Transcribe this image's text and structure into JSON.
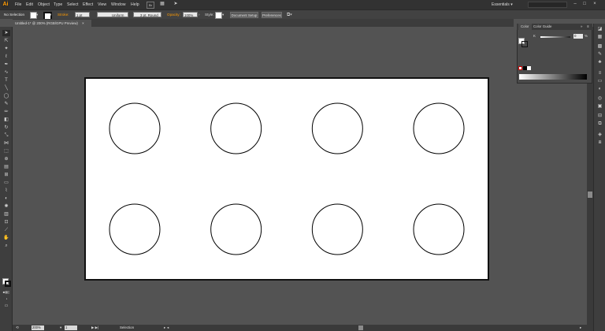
{
  "app": {
    "logo": "Ai"
  },
  "menu": [
    "File",
    "Edit",
    "Object",
    "Type",
    "Select",
    "Effect",
    "View",
    "Window",
    "Help"
  ],
  "workspace": "Essentials",
  "control_bar": {
    "selection_label": "No Selection",
    "stroke_label": "Stroke:",
    "stroke_weight": "1 pt",
    "profile": "Uniform",
    "brush": "3 pt. Round",
    "opacity_label": "Opacity:",
    "opacity_value": "100%",
    "style_label": "Style:",
    "document_setup": "Document Setup",
    "preferences": "Preferences"
  },
  "document_tab": "Untitled-1* @ 200% (RGB/GPU Preview)",
  "artboard": {
    "circle_rows": 2,
    "circle_cols": 4
  },
  "color_panel": {
    "tab_color": "Color",
    "tab_color_guide": "Color Guide",
    "tint_label": "K",
    "tint_value": "0",
    "tint_unit": "%"
  },
  "status": {
    "zoom": "200%",
    "page": "1",
    "tool_name": "Selection"
  },
  "colors": {
    "accent": "#ff9a00",
    "panel": "#4a4a4a",
    "canvas": "#535353"
  }
}
